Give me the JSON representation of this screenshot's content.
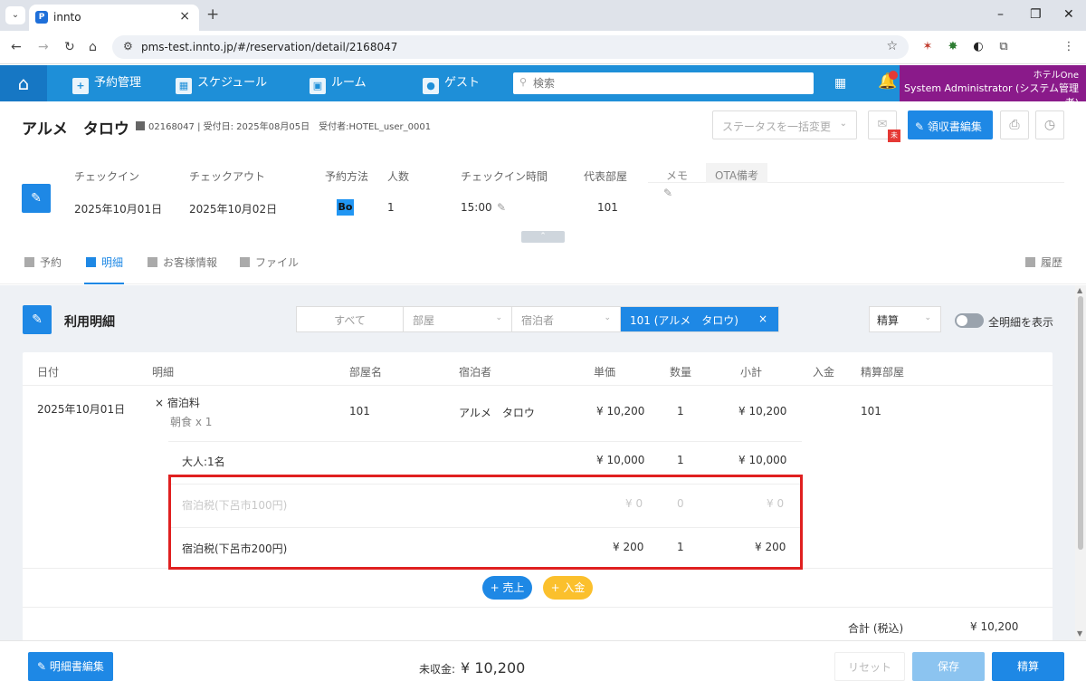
{
  "browser": {
    "tab_title": "innto",
    "tab_favicon": "P",
    "url": "pms-test.innto.jp/#/reservation/detail/2168047"
  },
  "nav": {
    "items": [
      {
        "label": "予約管理",
        "icon": "calendar-plus-icon"
      },
      {
        "label": "スケジュール",
        "icon": "schedule-icon"
      },
      {
        "label": "ルーム",
        "icon": "room-icon"
      },
      {
        "label": "ゲスト",
        "icon": "guest-icon"
      }
    ],
    "search_placeholder": "検索",
    "hotel": "ホテルOne",
    "user": "System Administrator (システム管理者)"
  },
  "reservation": {
    "guest_name": "アルメ　タロウ",
    "meta": "02168047 | 受付日: 2025年08月05日　受付者:HOTEL_user_0001",
    "status_placeholder": "ステータスを一括変更",
    "mail_badge": "未",
    "receipt_edit": "領収書編集"
  },
  "summary": {
    "labels": {
      "checkin": "チェックイン",
      "checkout": "チェックアウト",
      "method": "予約方法",
      "people": "人数",
      "checkin_time": "チェックイン時間",
      "room": "代表部屋"
    },
    "values": {
      "checkin": "2025年10月01日",
      "checkout": "2025年10月02日",
      "method_badge": "Bo",
      "people": "1",
      "checkin_time": "15:00",
      "room": "101"
    },
    "memo_tabs": [
      "メモ",
      "OTA備考"
    ]
  },
  "subtabs": [
    {
      "label": "予約",
      "active": false
    },
    {
      "label": "明細",
      "active": true
    },
    {
      "label": "お客様情報",
      "active": false
    },
    {
      "label": "ファイル",
      "active": false
    }
  ],
  "history_label": "履歴",
  "detail": {
    "title": "利用明細",
    "filter": {
      "all": "すべて",
      "room": "部屋",
      "guest": "宿泊者",
      "selected": "101 (アルメ　タロウ)"
    },
    "settlement": "精算",
    "toggle_label": "全明細を表示",
    "columns": [
      "日付",
      "明細",
      "部屋名",
      "宿泊者",
      "単価",
      "数量",
      "小計",
      "入金",
      "精算部屋"
    ],
    "row": {
      "date": "2025年10月01日",
      "item": "宿泊料",
      "item_sub": "朝食 x 1",
      "room": "101",
      "guest": "アルメ　タロウ",
      "unit": "¥ 10,200",
      "qty": "1",
      "subtotal": "¥ 10,200",
      "settle_room": "101"
    },
    "sub_rows": [
      {
        "label": "大人:1名",
        "unit": "¥ 10,000",
        "qty": "1",
        "subtotal": "¥ 10,000",
        "muted": false
      },
      {
        "label": "宿泊税(下呂市100円)",
        "unit": "¥ 0",
        "qty": "0",
        "subtotal": "¥ 0",
        "muted": true
      },
      {
        "label": "宿泊税(下呂市200円)",
        "unit": "¥ 200",
        "qty": "1",
        "subtotal": "¥ 200",
        "muted": false
      }
    ],
    "add_sale": "+ 売上",
    "add_payment": "+ 入金",
    "total_label": "合計 (税込)",
    "total_value": "¥ 10,200"
  },
  "footer": {
    "edit_statement": "明細書編集",
    "unpaid_label": "未収金:",
    "unpaid_value": "¥ 10,200",
    "reset": "リセット",
    "save": "保存",
    "settle": "精算"
  },
  "colors": {
    "header_blue": "#1e8fd8",
    "accent": "#1e88e5",
    "user_purple": "#8a1a8a",
    "highlight_red": "#e02020",
    "payment_yellow": "#fbc02d"
  }
}
